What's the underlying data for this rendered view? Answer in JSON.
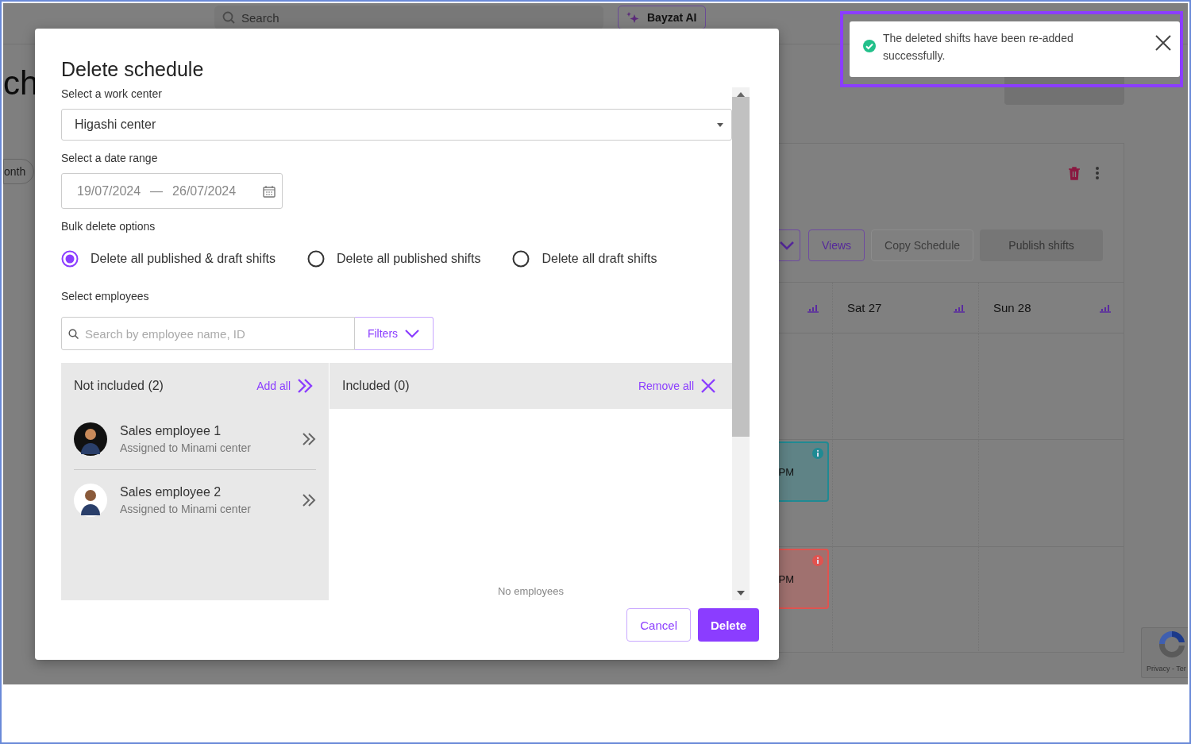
{
  "app": {
    "search": {
      "placeholder": "Search"
    },
    "ai_button": "Bayzat AI",
    "page_title": "ch",
    "view_pill": "onth",
    "toolbar": [
      {
        "label": "Views",
        "kind": "secondary",
        "disabled": false
      },
      {
        "label": "Copy Schedule",
        "kind": "secondary",
        "disabled": true
      },
      {
        "label": "Publish shifts",
        "kind": "primary",
        "disabled": true
      }
    ],
    "days": [
      {
        "label": "Sat 27"
      },
      {
        "label": "Sun 28"
      }
    ],
    "shifts": [
      {
        "time": "PM",
        "color": "#1f8a93"
      },
      {
        "time": "PM",
        "color": "#e0534f"
      }
    ],
    "recaptcha": "Privacy - Ter"
  },
  "dialog": {
    "title": "Delete schedule",
    "work_center": {
      "label": "Select a work center",
      "value": "Higashi center"
    },
    "date_range": {
      "label": "Select a date range",
      "start": "19/07/2024",
      "separator": "—",
      "end": "26/07/2024"
    },
    "bulk_options": {
      "label": "Bulk delete options",
      "options": [
        {
          "label": "Delete all published & draft shifts",
          "selected": true
        },
        {
          "label": "Delete all published shifts",
          "selected": false
        },
        {
          "label": "Delete all draft shifts",
          "selected": false
        }
      ]
    },
    "employees": {
      "label": "Select employees",
      "search": {
        "placeholder": "Search by employee name, ID"
      },
      "filters_button": "Filters",
      "not_included": {
        "title": "Not included (2)",
        "action": "Add all",
        "items": [
          {
            "name": "Sales employee 1",
            "subtitle": "Assigned to Minami center"
          },
          {
            "name": "Sales employee 2",
            "subtitle": "Assigned to Minami center"
          }
        ]
      },
      "included": {
        "title": "Included (0)",
        "action": "Remove all",
        "empty": "No employees"
      }
    },
    "buttons": [
      {
        "label": "Cancel",
        "kind": "secondary"
      },
      {
        "label": "Delete",
        "kind": "primary"
      }
    ]
  },
  "toast": {
    "kind": "success",
    "message": "The deleted shifts have been re-added successfully."
  }
}
